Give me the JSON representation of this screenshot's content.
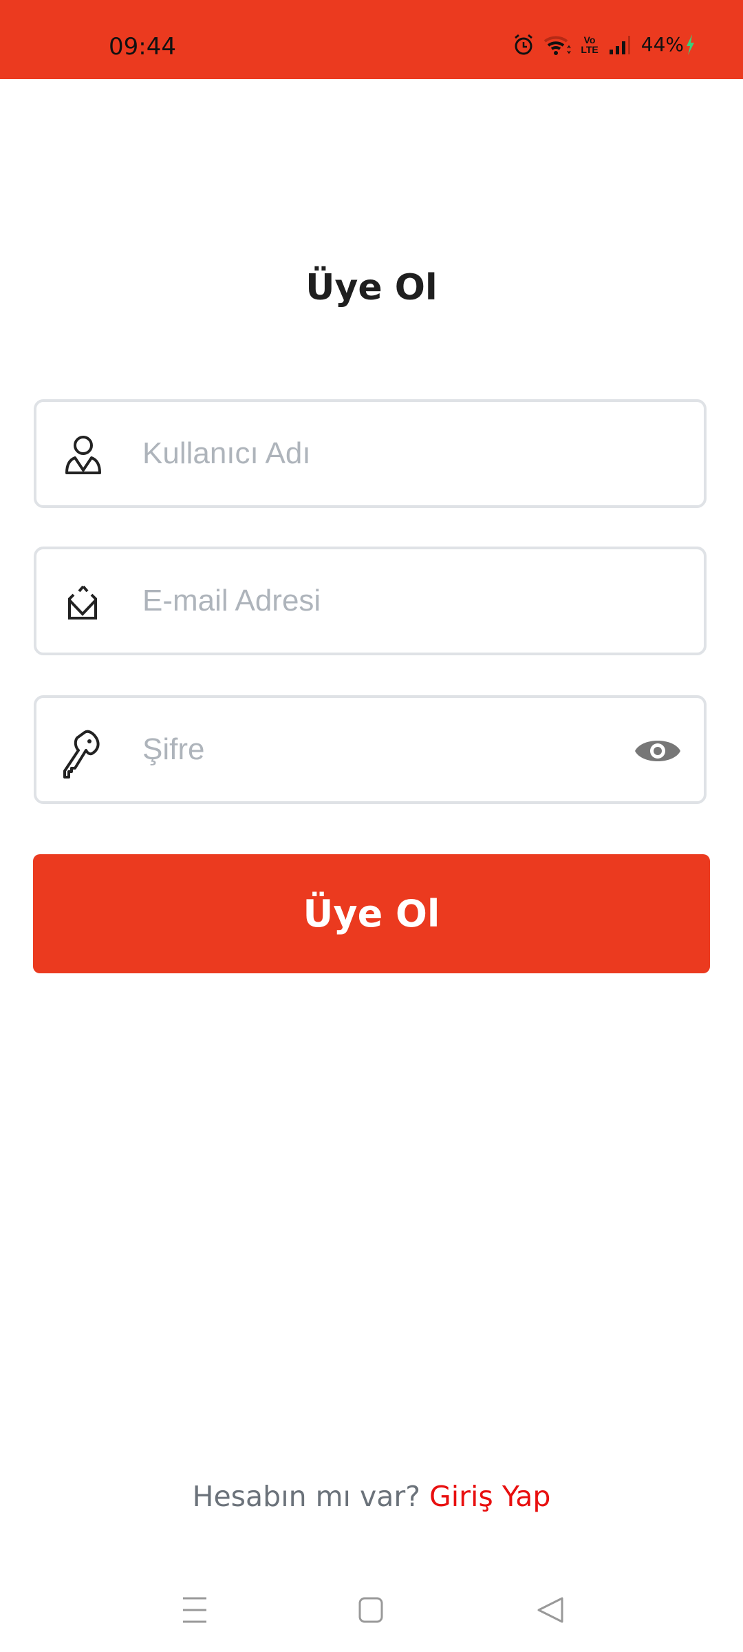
{
  "status_bar": {
    "time": "09:44",
    "battery": "44%",
    "icons": [
      "alarm-icon",
      "wifi-icon",
      "volte-icon",
      "signal-icon",
      "charging-icon"
    ],
    "volte_label_top": "Vo",
    "volte_label_bottom": "LTE"
  },
  "page": {
    "title": "Üye Ol",
    "fields": [
      {
        "placeholder": "Kullanıcı Adı",
        "value": "",
        "icon": "user-icon"
      },
      {
        "placeholder": "E-mail Adresi",
        "value": "",
        "icon": "mail-open-icon"
      },
      {
        "placeholder": "Şifre",
        "value": "",
        "icon": "key-icon",
        "trailing_icon": "eye-icon"
      }
    ],
    "submit_label": "Üye Ol",
    "footer_question": "Hesabın mı var?",
    "footer_link": "Giriş Yap"
  },
  "colors": {
    "accent": "#EB3A1F",
    "link": "#E80F0F",
    "placeholder": "#AEB4BB",
    "border": "#DFE2E6"
  },
  "nav_bar": {
    "icons": [
      "menu-icon",
      "home-icon",
      "back-icon"
    ]
  }
}
